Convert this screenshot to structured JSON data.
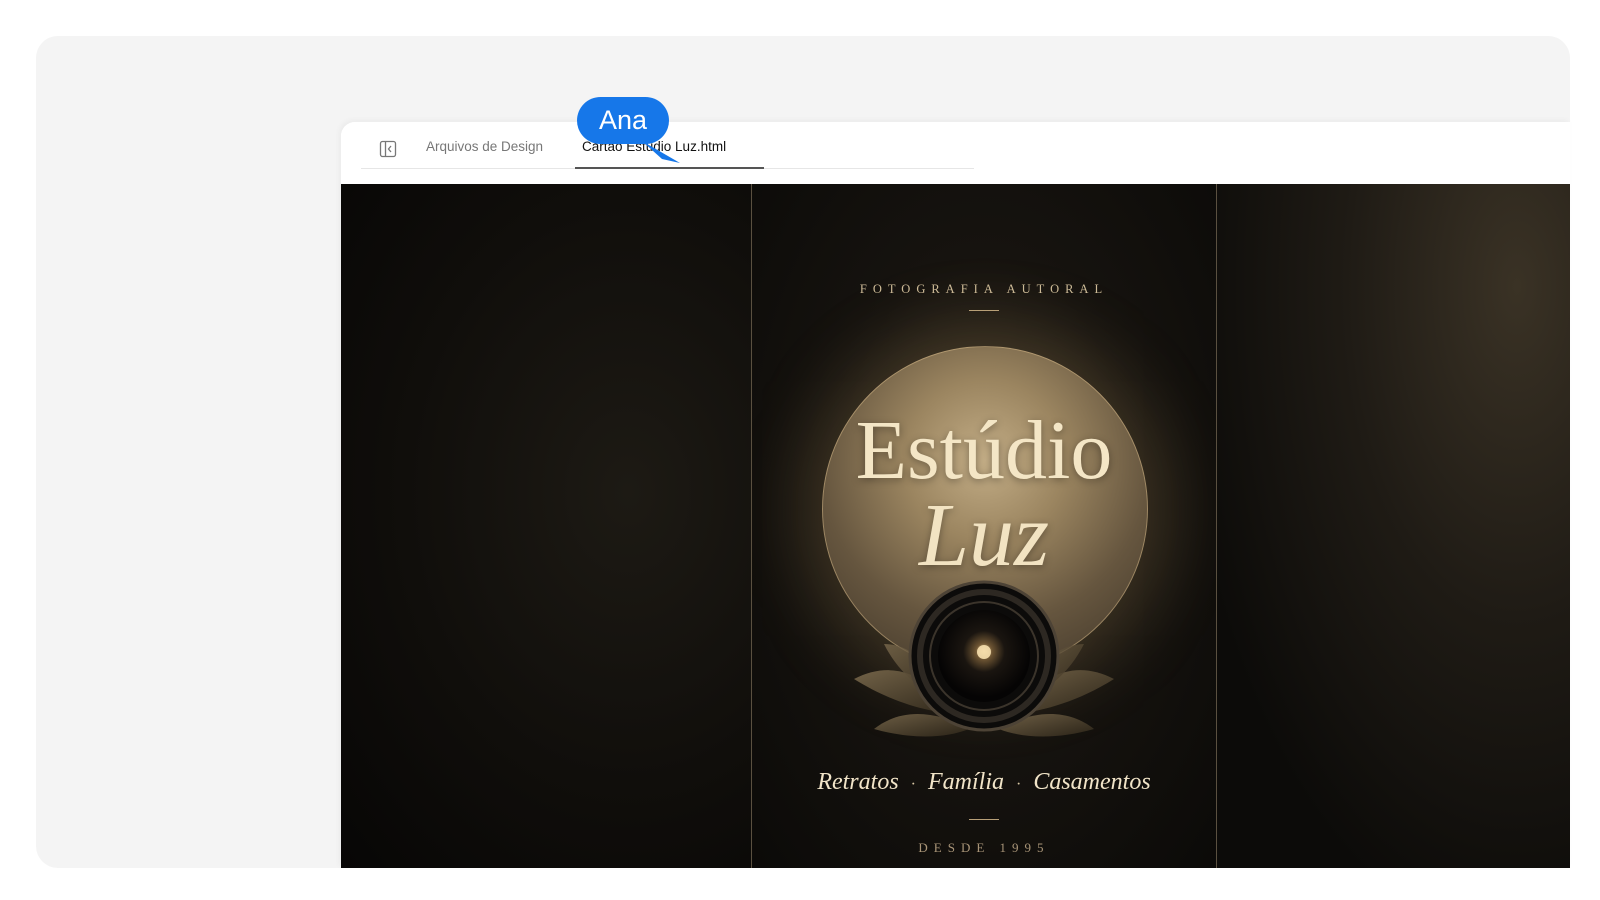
{
  "tabs": {
    "inactive_label": "Arquivos de Design",
    "active_label": "Cartão Estúdio Luz.html"
  },
  "card": {
    "kicker": "FOTOGRAFIA AUTORAL",
    "title_line1": "Estúdio",
    "title_line2": "Luz",
    "services": [
      "Retratos",
      "Família",
      "Casamentos"
    ],
    "separator": "·",
    "since": "DESDE 1995"
  },
  "cursor": {
    "name": "Ana",
    "color": "#1677e9"
  },
  "icons": {
    "sidebar_toggle": "sidebar-toggle-icon"
  },
  "colors": {
    "gold": "#cdbb98",
    "accent_blue": "#1677e9"
  }
}
